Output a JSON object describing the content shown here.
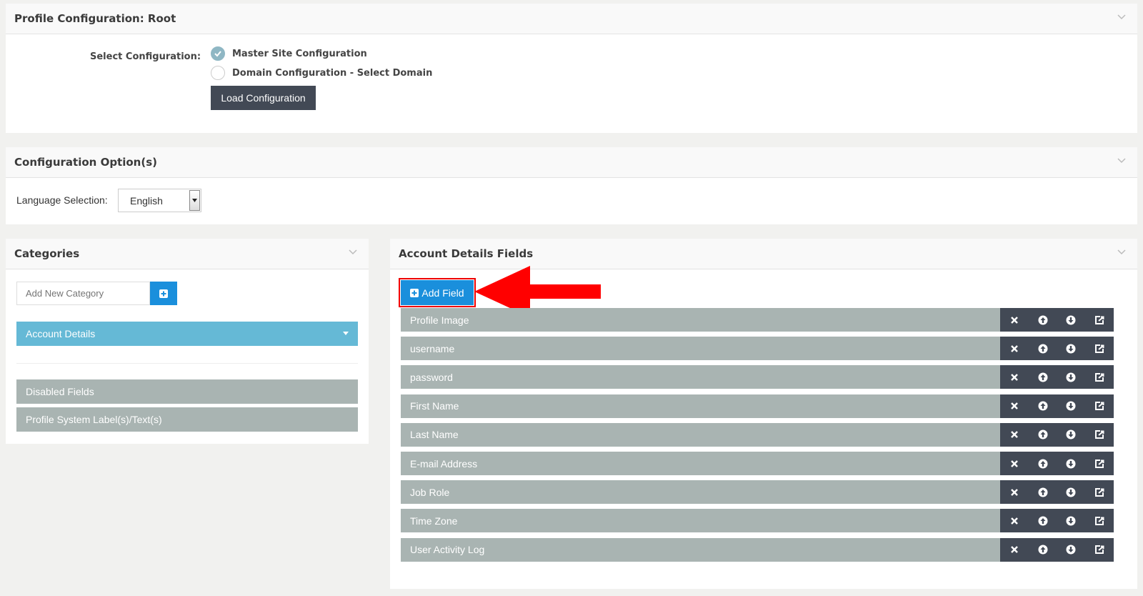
{
  "profile_panel": {
    "title": "Profile Configuration: Root",
    "select_label": "Select Configuration:",
    "options": [
      {
        "label": "Master Site Configuration",
        "checked": true
      },
      {
        "label": "Domain Configuration - Select Domain",
        "checked": false
      }
    ],
    "load_button": "Load Configuration"
  },
  "options_panel": {
    "title": "Configuration Option(s)",
    "language_label": "Language Selection:",
    "language_value": "English"
  },
  "categories_panel": {
    "title": "Categories",
    "add_placeholder": "Add New Category",
    "items": [
      {
        "label": "Account Details",
        "active": true
      },
      {
        "label": "Disabled Fields",
        "active": false
      },
      {
        "label": "Profile System Label(s)/Text(s)",
        "active": false
      }
    ]
  },
  "fields_panel": {
    "title": "Account Details Fields",
    "add_button": "Add Field",
    "rows": [
      {
        "label": "Profile Image"
      },
      {
        "label": "username"
      },
      {
        "label": "password"
      },
      {
        "label": "First Name"
      },
      {
        "label": "Last Name"
      },
      {
        "label": "E-mail Address"
      },
      {
        "label": "Job Role"
      },
      {
        "label": "Time Zone"
      },
      {
        "label": "User Activity Log"
      }
    ],
    "row_actions": [
      "close-icon",
      "arrow-up-icon",
      "arrow-down-icon",
      "external-link-icon"
    ]
  },
  "colors": {
    "accent_blue": "#1a8fdc",
    "active_category": "#65b9d6",
    "disabled_row": "#a9b4b2",
    "dark_button": "#424955",
    "annotation_red": "#ff0000"
  }
}
